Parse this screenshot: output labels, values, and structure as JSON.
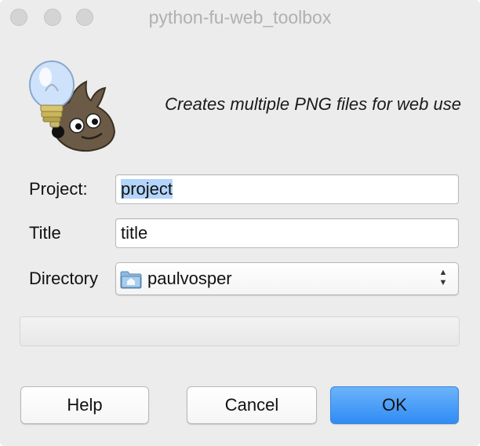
{
  "window": {
    "title": "python-fu-web_toolbox"
  },
  "header": {
    "description": "Creates multiple PNG files for web use",
    "logo_icon": "gimp-wilber-lightbulb-icon"
  },
  "form": {
    "project": {
      "label": "Project:",
      "value": "project"
    },
    "title": {
      "label": "Title",
      "value": "title"
    },
    "directory": {
      "label": "Directory",
      "value": "paulvosper",
      "icon": "home-folder-icon",
      "arrow_up": "▲",
      "arrow_down": "▼"
    }
  },
  "progress": {
    "fraction": 0
  },
  "buttons": {
    "help": "Help",
    "cancel": "Cancel",
    "ok": "OK"
  },
  "colors": {
    "window_bg": "#ececec",
    "selection": "#b3d4fb",
    "accent": "#3d8ef5"
  }
}
